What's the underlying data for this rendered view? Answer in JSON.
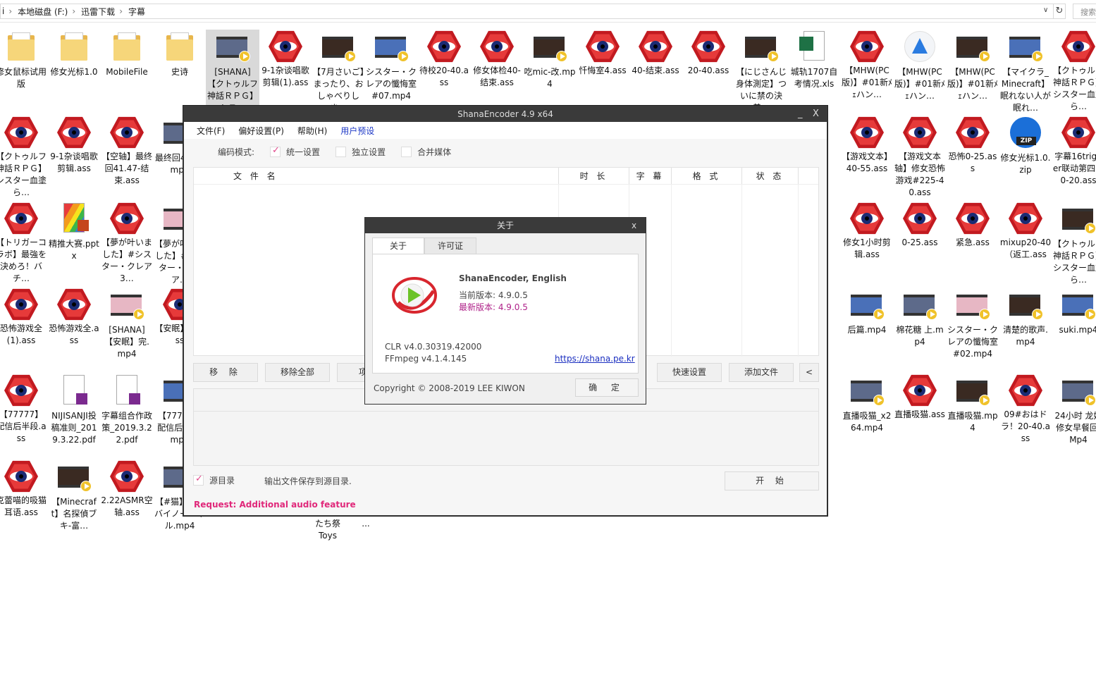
{
  "explorer": {
    "breadcrumb": [
      "本地磁盘 (F:)",
      "迅雷下载",
      "字幕"
    ],
    "breadcrumb_prefix": "i",
    "search_placeholder": "搜索"
  },
  "files": [
    {
      "label": "修女鼠标试用版",
      "icon": "folder"
    },
    {
      "label": "修女光标1.0",
      "icon": "folder"
    },
    {
      "label": "MobileFile",
      "icon": "folder"
    },
    {
      "label": "史诗",
      "icon": "folder"
    },
    {
      "label": "[SHANA]【クトゥルフ神話ＲＰＧ】シス…",
      "icon": "video",
      "selected": true
    },
    {
      "label": "9-1杂谈唱歌剪辑(1).ass",
      "icon": "eye"
    },
    {
      "label": "【7月さいご】まったり、おしゃべりしま…",
      "icon": "video"
    },
    {
      "label": "シスター・クレアの懺悔室#07.mp4",
      "icon": "video"
    },
    {
      "label": "待校20-40.ass",
      "icon": "eye"
    },
    {
      "label": "修女体检40-结束.ass",
      "icon": "eye"
    },
    {
      "label": "吃mic-改.mp4",
      "icon": "video"
    },
    {
      "label": "忏悔室4.ass",
      "icon": "eye"
    },
    {
      "label": "40-结束.ass",
      "icon": "eye"
    },
    {
      "label": "20-40.ass",
      "icon": "eye"
    },
    {
      "label": "【にじさんじ身体測定】ついに禁の決着…",
      "icon": "video"
    },
    {
      "label": "城轨1707自考情况.xls",
      "icon": "xls"
    },
    {
      "label": "【MHW(PC版)】#01新ﾒｪハン…",
      "icon": "eye"
    },
    {
      "label": "【MHW(PC版)】#01新ﾒｪハン…",
      "icon": "app"
    },
    {
      "label": "【MHW(PC版)】#01新ﾒｪハン…",
      "icon": "video"
    },
    {
      "label": "【マイクラ_Minecraft】眠れない人が眠れ…",
      "icon": "video"
    },
    {
      "label": "【クトゥルフ神話ＲＰＧ】シスター血塗ら…",
      "icon": "eye"
    },
    {
      "label": "【クトゥルフ神話ＲＰＧ】シスター血塗ら…",
      "icon": "eye"
    },
    {
      "label": "9-1杂谈唱歌剪辑.ass",
      "icon": "eye"
    },
    {
      "label": "【空轴】最终回41.47-结束.ass",
      "icon": "eye"
    },
    {
      "label": "最终回480p.mp4",
      "icon": "video"
    },
    {
      "label": "【游戏文本】40-55.ass",
      "icon": "eye"
    },
    {
      "label": "【游戏文本轴】修女恐怖游戏#225-40.ass",
      "icon": "eye"
    },
    {
      "label": "恐怖0-25.ass",
      "icon": "eye"
    },
    {
      "label": "修女光标1.0.zip",
      "icon": "zip"
    },
    {
      "label": "字幕16trigger联动第四回0-20.ass",
      "icon": "eye"
    },
    {
      "label": "【トリガーコラボ】最強を決めろ！バチ…",
      "icon": "eye"
    },
    {
      "label": "精推大赛.pptx",
      "icon": "ppt"
    },
    {
      "label": "【夢が叶いました】#シスター・クレア3…",
      "icon": "eye"
    },
    {
      "label": "【夢が叶いました】#シスター・クレア…",
      "icon": "video"
    },
    {
      "label": "修女1小时剪辑.ass",
      "icon": "eye"
    },
    {
      "label": "0-25.ass",
      "icon": "eye"
    },
    {
      "label": "紧急.ass",
      "icon": "eye"
    },
    {
      "label": "mixup20-40（返工.ass",
      "icon": "eye"
    },
    {
      "label": "【クトゥルフ神話ＲＰＧ】シスター血塗ら…",
      "icon": "video"
    },
    {
      "label": "恐怖游戏全(1).ass",
      "icon": "eye"
    },
    {
      "label": "恐怖游戏全.ass",
      "icon": "eye"
    },
    {
      "label": "[SHANA]【安眠】完.mp4",
      "icon": "video"
    },
    {
      "label": "【安眠】完.ass",
      "icon": "eye"
    },
    {
      "label": "后篇.mp4",
      "icon": "video"
    },
    {
      "label": "棉花糖 上.mp4",
      "icon": "video"
    },
    {
      "label": "シスター・クレアの懺悔室#02.mp4",
      "icon": "video"
    },
    {
      "label": "清楚的歌声.mp4",
      "icon": "video"
    },
    {
      "label": "suki.mp4",
      "icon": "video"
    },
    {
      "label": "【77777】配信后半段.ass",
      "icon": "eye"
    },
    {
      "label": "NIJISANJI投稿准则_2019.3.22.pdf",
      "icon": "doc"
    },
    {
      "label": "字幕组合作政策_2019.3.22.pdf",
      "icon": "doc"
    },
    {
      "label": "【77777】配信后半段.mp4",
      "icon": "video"
    },
    {
      "label": "直播吸猫_x264.mp4",
      "icon": "video"
    },
    {
      "label": "直播吸猫.ass",
      "icon": "eye"
    },
    {
      "label": "直播吸猫.mp4",
      "icon": "video"
    },
    {
      "label": "09#おはドラ！20-40.ass",
      "icon": "eye"
    },
    {
      "label": "24小时 龙妈修女早餐回.Mp4",
      "icon": "video"
    },
    {
      "label": "克蕾喵的吸猫耳语.ass",
      "icon": "eye"
    },
    {
      "label": "【Minecraft】名探偵ブキ-富…",
      "icon": "video"
    },
    {
      "label": "2.22ASMR空轴.ass",
      "icon": "eye"
    },
    {
      "label": "【#猫】おやバイノーニャル.mp4",
      "icon": "video"
    }
  ],
  "hidden_strips": {
    "col6_row7": "たち祭Toys",
    "col7_row7": "..."
  },
  "shana": {
    "title": "ShanaEncoder 4.9 x64",
    "minimize": "_",
    "close": "X",
    "menu": [
      "文件(F)",
      "偏好设置(P)",
      "帮助(H)",
      "用户预设"
    ],
    "mode_label": "编码模式:",
    "modes": [
      {
        "label": "统一设置",
        "checked": true
      },
      {
        "label": "独立设置",
        "checked": false
      },
      {
        "label": "合并媒体",
        "checked": false
      }
    ],
    "columns": [
      "文 件 名",
      "时 长",
      "字 幕",
      "格 式",
      "状 态"
    ],
    "buttons": {
      "remove": "移 除",
      "remove_all": "移除全部",
      "item": "项",
      "quick_settings": "快速设置",
      "add_file": "添加文件",
      "collapse": "<"
    },
    "source_dir_label": "源目录",
    "source_dir_checked": true,
    "output_text": "输出文件保存到源目录.",
    "start": "开 始",
    "request": "Request: Additional audio feature"
  },
  "about": {
    "title": "关于",
    "close": "x",
    "tabs": [
      "关于",
      "许可证"
    ],
    "product": "ShanaEncoder, English",
    "current_version": "当前版本: 4.9.0.5",
    "latest_version": "最新版本: 4.9.0.5",
    "clr": "CLR v4.0.30319.42000",
    "ffmpeg": "FFmpeg v4.1.4.145",
    "link": "https://shana.pe.kr",
    "copyright": "Copyright © 2008-2019 LEE KIWON",
    "ok": "确 定"
  },
  "colors": {
    "shana_title_bg": "#3a3a3a",
    "menu_active": "#1d38c6",
    "request": "#e0287a",
    "latest_version": "#b0238a",
    "check": "#e0468a"
  }
}
